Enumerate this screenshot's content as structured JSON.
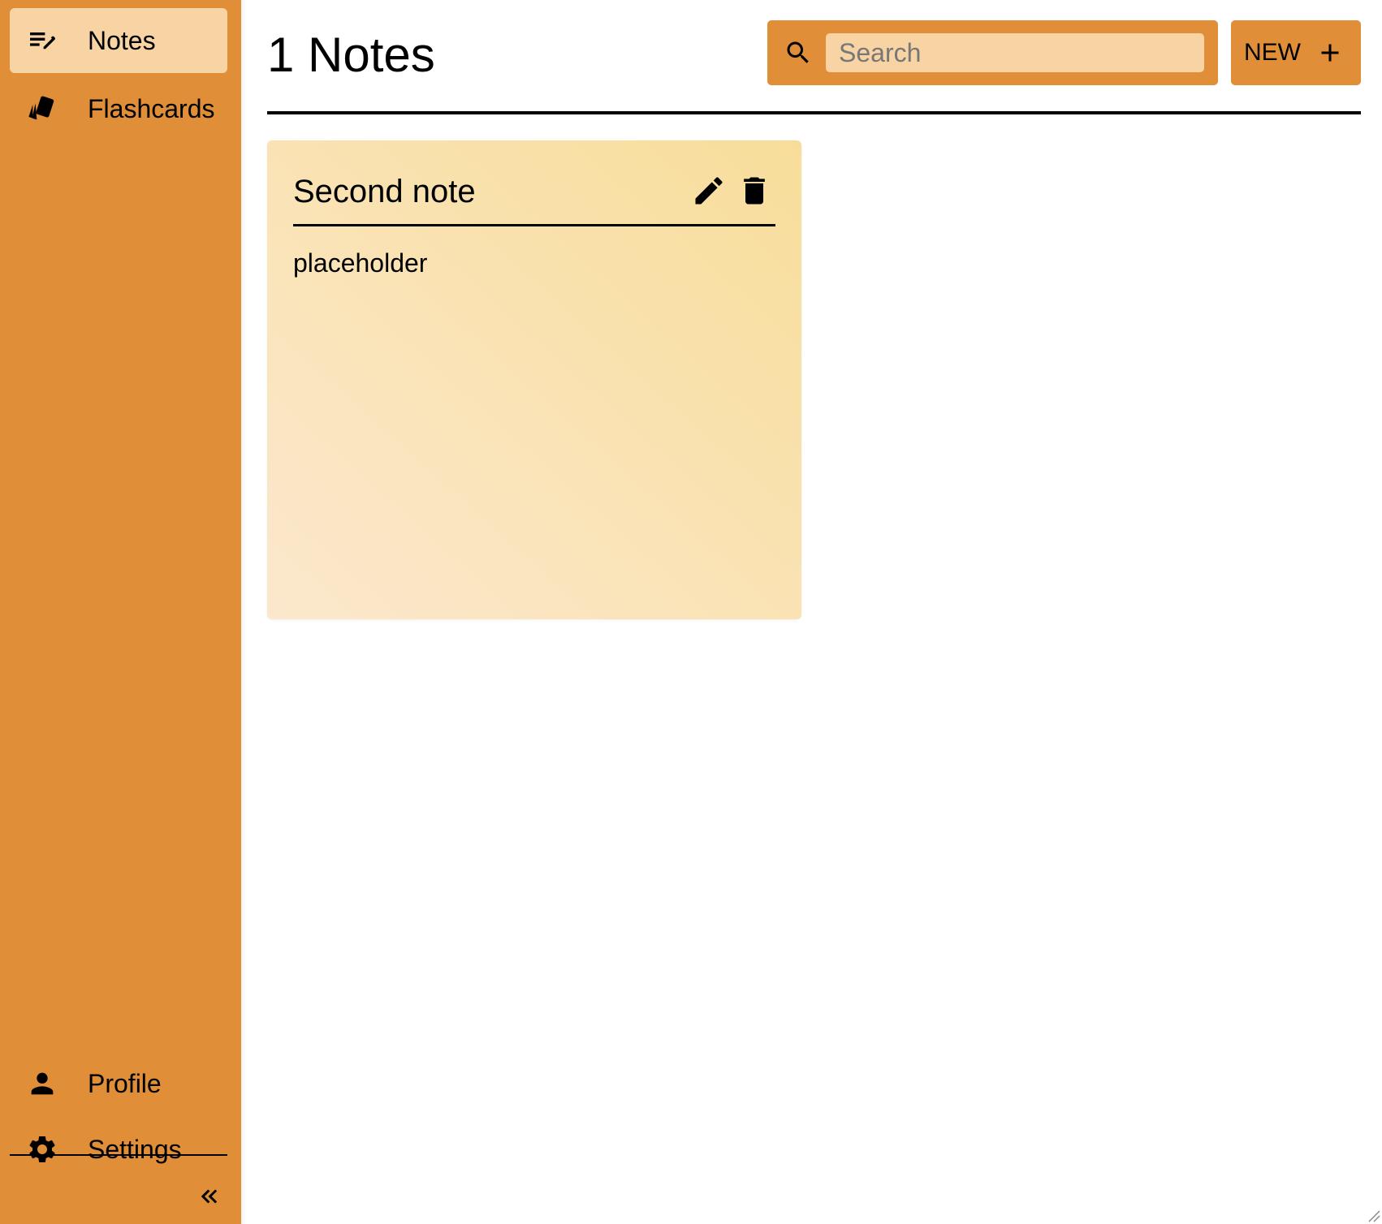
{
  "sidebar": {
    "items": [
      {
        "label": "Notes",
        "icon": "notes-edit-icon",
        "active": true
      },
      {
        "label": "Flashcards",
        "icon": "flashcards-icon",
        "active": false
      }
    ],
    "bottom_items": [
      {
        "label": "Profile",
        "icon": "person-icon"
      },
      {
        "label": "Settings",
        "icon": "gear-icon"
      }
    ],
    "collapse_icon": "double-chevron-left-icon"
  },
  "header": {
    "title": "1 Notes",
    "search": {
      "placeholder": "Search",
      "value": ""
    },
    "new_button_label": "NEW"
  },
  "notes": [
    {
      "title": "Second note",
      "body": "placeholder"
    }
  ],
  "colors": {
    "sidebar": "#e08e38",
    "active_item": "#f8d3a4",
    "search_field": "#f8d3a4",
    "note_gradient_start": "#fbe8cd",
    "note_gradient_end": "#f8dd9a"
  }
}
